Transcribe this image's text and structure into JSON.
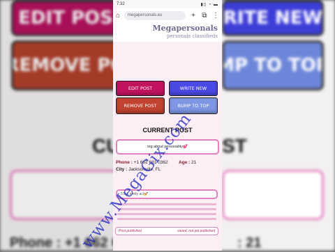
{
  "status": {
    "time": "7:32",
    "icons": "▮▯ ◔ ▬"
  },
  "browser": {
    "url": "megapersonals.eu",
    "tab_count": "⧉"
  },
  "logo": {
    "title": "Megapersonals",
    "subtitle": "personals classifieds"
  },
  "buttons": {
    "edit": "EDIT POST",
    "write": "WRITE NEW",
    "remove": "REMOVE POST",
    "bump": "BUMP TO TOP"
  },
  "current": {
    "heading": "CURRENT POST",
    "title": "ing about personality💕",
    "phone_label": "Phone :",
    "phone_value": "+1 662 681 0362",
    "age_label": "Age :",
    "age_value": "21",
    "city_label": "City :",
    "city_value": "Jacksonville, FL",
    "body": "5'5 & pretty act💅"
  },
  "footer": {
    "left": "Post published",
    "right": "saved, not yet published"
  },
  "background": {
    "edit": "EDIT POS",
    "write": "RITE NEW",
    "remove": "REMOVE PO",
    "bump": "MP TO TOP",
    "heading_left": "CU",
    "heading_right": "ST",
    "phone": "Phone : +1 662 6",
    "age": ": 21"
  },
  "watermark": "www.MegaGix.com",
  "colors": {
    "edit": "#c2135f",
    "write": "#4b49e4",
    "remove": "#c14330",
    "bump": "#7f96e4",
    "accent": "#e281be"
  }
}
